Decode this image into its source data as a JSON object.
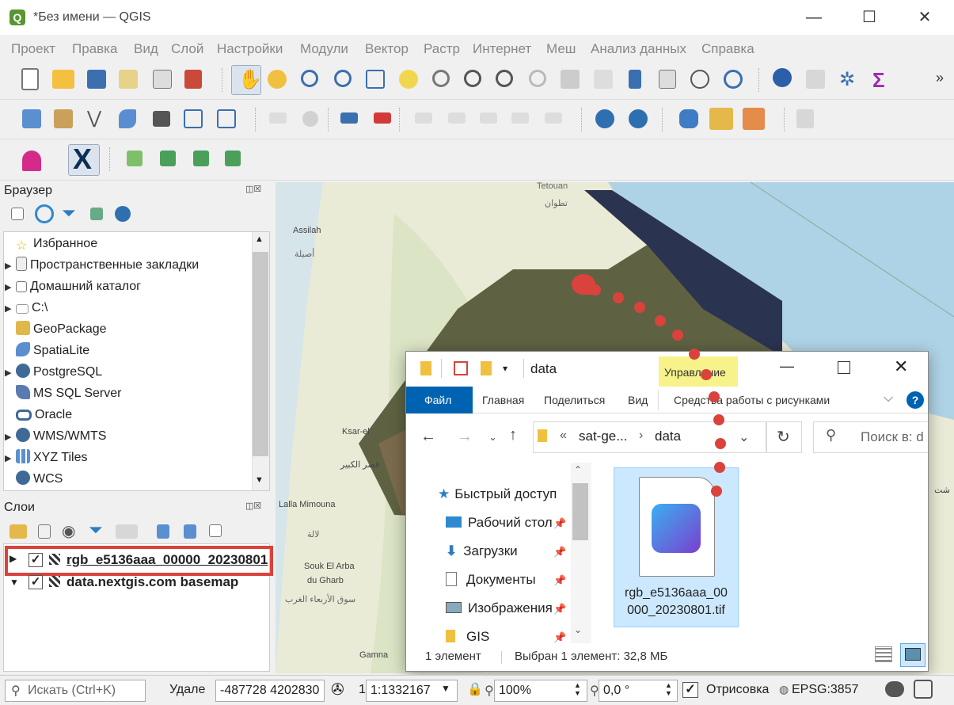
{
  "window": {
    "title": "*Без имени — QGIS",
    "minimize": "—",
    "maximize": "☐",
    "close": "✕"
  },
  "menu": [
    "Проект",
    "Правка",
    "Вид",
    "Слой",
    "Настройки",
    "Модули",
    "Вектор",
    "Растр",
    "Интернет",
    "Меш",
    "Анализ данных",
    "Справка"
  ],
  "toolbar": {
    "overflow": "»"
  },
  "browser": {
    "title": "Браузер",
    "items": [
      {
        "label": "Избранное",
        "icon": "star-icon"
      },
      {
        "label": "Пространственные закладки",
        "icon": "bookmark-icon"
      },
      {
        "label": "Домашний каталог",
        "icon": "home-folder-icon"
      },
      {
        "label": "C:\\",
        "icon": "drive-icon"
      },
      {
        "label": "GeoPackage",
        "icon": "geopackage-icon"
      },
      {
        "label": "SpatiaLite",
        "icon": "spatialite-icon"
      },
      {
        "label": "PostgreSQL",
        "icon": "postgresql-icon"
      },
      {
        "label": "MS SQL Server",
        "icon": "mssql-icon"
      },
      {
        "label": "Oracle",
        "icon": "oracle-icon"
      },
      {
        "label": "WMS/WMTS",
        "icon": "wms-icon"
      },
      {
        "label": "XYZ Tiles",
        "icon": "xyz-tiles-icon"
      },
      {
        "label": "WCS",
        "icon": "wcs-icon"
      }
    ]
  },
  "layers": {
    "title": "Слои",
    "items": [
      {
        "label": "rgb_e5136aaa_00000_20230801",
        "checked": "✓"
      },
      {
        "label": "data.nextgis.com basemap",
        "checked": "✓"
      }
    ]
  },
  "map": {
    "places": [
      "Tetouan",
      "تطوان",
      "Assilah",
      "أصيلة",
      "Ksar-el",
      "قصر الكبير",
      "Lalla Mimouna",
      "لالة",
      "Souk El Arba",
      "du Gharb",
      "سوق الأربعاء الغرب",
      "Gamna",
      "شت"
    ]
  },
  "explorer": {
    "path_title": "data",
    "manage_tab": "Управление",
    "tabs": [
      "Файл",
      "Главная",
      "Поделиться",
      "Вид",
      "Средства работы с рисунками"
    ],
    "help": "?",
    "breadcrumb": {
      "prefix": "«",
      "parent": "sat-ge...",
      "sep": "›",
      "current": "data"
    },
    "search_placeholder": "Поиск в: d",
    "nav": [
      {
        "label": "Быстрый доступ",
        "icon": "star-icon"
      },
      {
        "label": "Рабочий стол",
        "icon": "desktop-icon"
      },
      {
        "label": "Загрузки",
        "icon": "download-icon"
      },
      {
        "label": "Документы",
        "icon": "documents-icon"
      },
      {
        "label": "Изображения",
        "icon": "pictures-icon"
      },
      {
        "label": "GIS",
        "icon": "folder-icon"
      }
    ],
    "file": {
      "name_line1": "rgb_e5136aaa_00",
      "name_line2": "000_20230801.tif"
    },
    "status_count": "1 элемент",
    "status_selected": "Выбран 1 элемент: 32,8 МБ"
  },
  "statusbar": {
    "search_placeholder": "Искать (Ctrl+K)",
    "coord_label": "Удале",
    "coordinate": "-487728 4202830",
    "scale_label": "1",
    "scale": "1:1332167",
    "magnifier": "100%",
    "rotation": "0,0 °",
    "render_label": "Отрисовка",
    "crs": "EPSG:3857"
  },
  "colors": {
    "accent": "#0063b1",
    "highlight": "#d9433c",
    "selected_file_bg": "#cce8ff"
  }
}
